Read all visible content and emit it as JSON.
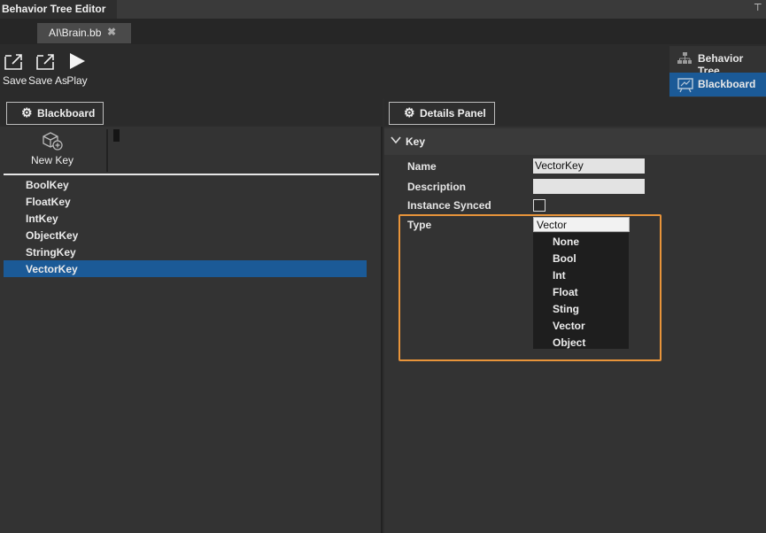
{
  "window": {
    "title": "Behavior Tree Editor"
  },
  "document_tab": {
    "label": "AI\\Brain.bb"
  },
  "toolbar": {
    "save_label": "Save",
    "save_as_label": "Save As",
    "play_label": "Play"
  },
  "view_switch": {
    "behavior_tree_label": "Behavior Tree",
    "blackboard_label": "Blackboard",
    "active": "Blackboard"
  },
  "blackboard_panel": {
    "header_label": "Blackboard",
    "new_key_label": "New Key",
    "keys": [
      "BoolKey",
      "FloatKey",
      "IntKey",
      "ObjectKey",
      "StringKey",
      "VectorKey"
    ],
    "selected_key": "VectorKey"
  },
  "details_panel": {
    "header_label": "Details Panel",
    "section_label": "Key",
    "name_label": "Name",
    "name_value": "VectorKey",
    "description_label": "Description",
    "description_value": "",
    "instance_synced_label": "Instance Synced",
    "instance_synced": false,
    "type_label": "Type",
    "type_value": "Vector",
    "type_options": [
      "None",
      "Bool",
      "Int",
      "Float",
      "Sting",
      "Vector",
      "Object"
    ]
  },
  "colors": {
    "accent_selected": "#1b5a97",
    "highlight_border": "#e8943a"
  }
}
